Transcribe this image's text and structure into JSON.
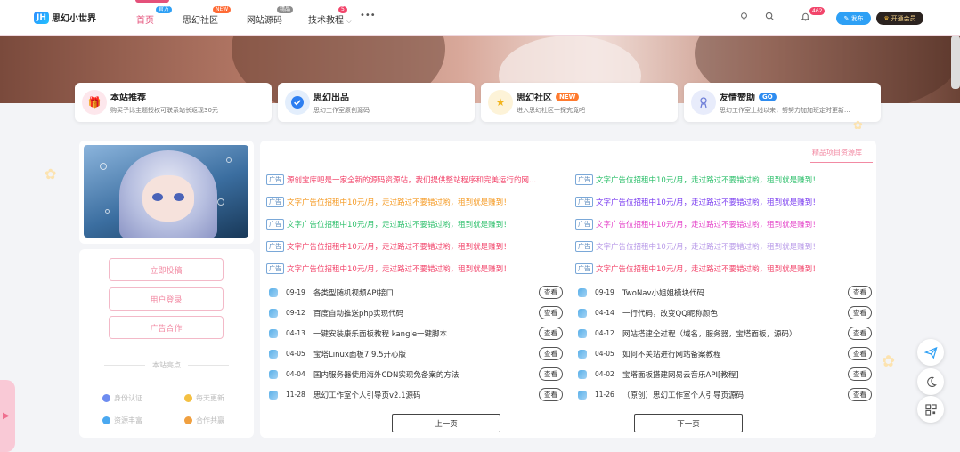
{
  "header": {
    "logo_mark": "JH",
    "site_name": "思幻小世界",
    "nav": [
      {
        "label": "首页",
        "tag": "官方",
        "tag_color": "#2ea0f5"
      },
      {
        "label": "思幻社区",
        "tag": "NEW",
        "tag_color": "#ff6b35"
      },
      {
        "label": "网站源码",
        "tag": "精品",
        "tag_color": "#8c8c8c"
      },
      {
        "label": "技术教程",
        "tag": "5",
        "tag_color": "#f2456b"
      }
    ],
    "more": "•••",
    "notification_count": "462",
    "publish_label": "发布",
    "vip_label": "开通会员"
  },
  "features": [
    {
      "title": "本站推荐",
      "tag": "",
      "desc": "购买子比主题授权可联系站长返现30元",
      "icon": "gift-icon"
    },
    {
      "title": "思幻出品",
      "tag": "",
      "desc": "思幻工作室原创源码",
      "icon": "check-badge-icon"
    },
    {
      "title": "思幻社区",
      "tag": "NEW",
      "desc": "进入思幻社区一探究竟吧",
      "icon": "star-icon"
    },
    {
      "title": "友情赞助",
      "tag": "GO",
      "desc": "思幻工作室上线以来，努努力加加班定时更新...",
      "icon": "user-badge-icon"
    }
  ],
  "sidebar": {
    "buttons": [
      "立即投稿",
      "用户登录",
      "广告合作"
    ],
    "section_title": "本站亮点",
    "features": [
      {
        "label": "身份认证",
        "color": "#6d8cf0"
      },
      {
        "label": "每天更新",
        "color": "#f4c042"
      },
      {
        "label": "资源丰富",
        "color": "#4aa8f0"
      },
      {
        "label": "合作共赢",
        "color": "#f0a040"
      }
    ]
  },
  "main": {
    "tab": "精品项目资源库",
    "ad_tag": "广告",
    "ads_left": [
      {
        "text": "源创宝库吧是一家全新的源码资源站，我们提供整站程序和完美运行的网...",
        "color": "#f2456b"
      },
      {
        "text": "文字广告位招租中10元/月，走过路过不要错过哟，租到就是赚到！",
        "color": "#f59a23"
      },
      {
        "text": "文字广告位招租中10元/月，走过路过不要错过哟，租到就是赚到！",
        "color": "#2bbf6a"
      },
      {
        "text": "文字广告位招租中10元/月，走过路过不要错过哟，租到就是赚到！",
        "color": "#f2456b"
      },
      {
        "text": "文字广告位招租中10元/月，走过路过不要错过哟，租到就是赚到！",
        "color": "#f2456b"
      }
    ],
    "ads_right": [
      {
        "text": "文字广告位招租中10元/月，走过路过不要错过哟，租到就是赚到！",
        "color": "#2bbf6a"
      },
      {
        "text": "文字广告位招租中10元/月，走过路过不要错过哟，租到就是赚到！",
        "color": "#7a3cf0"
      },
      {
        "text": "文字广告位招租中10元/月，走过路过不要错过哟，租到就是赚到！",
        "color": "#e440c8"
      },
      {
        "text": "文字广告位招租中10元/月，走过路过不要错过哟，租到就是赚到！",
        "color": "#b89ae8"
      },
      {
        "text": "文字广告位招租中10元/月，走过路过不要错过哟，租到就是赚到！",
        "color": "#f2456b"
      }
    ],
    "view_label": "查看",
    "posts_left": [
      {
        "date": "09-19",
        "title": "各类型随机视频API接口"
      },
      {
        "date": "09-12",
        "title": "百度自动推送php实现代码"
      },
      {
        "date": "04-13",
        "title": "一键安装康乐面板教程 kangle一键脚本"
      },
      {
        "date": "04-05",
        "title": "宝塔Linux面板7.9.5开心版"
      },
      {
        "date": "04-04",
        "title": "国内服务器使用海外CDN实现免备案的方法"
      },
      {
        "date": "11-28",
        "title": "思幻工作室个人引导页v2.1源码"
      }
    ],
    "posts_right": [
      {
        "date": "09-19",
        "title": "TwoNav小姐姐模块代码"
      },
      {
        "date": "04-14",
        "title": "一行代码，改变QQ昵称颜色"
      },
      {
        "date": "04-12",
        "title": "网站搭建全过程（域名，服务器，宝塔面板，源码）"
      },
      {
        "date": "04-05",
        "title": "如何不关站进行网站备案教程"
      },
      {
        "date": "04-02",
        "title": "宝塔面板搭建网易云音乐API[教程]"
      },
      {
        "date": "11-26",
        "title": "（原创）思幻工作室个人引导页源码"
      }
    ],
    "prev_label": "上一页",
    "next_label": "下一页"
  }
}
